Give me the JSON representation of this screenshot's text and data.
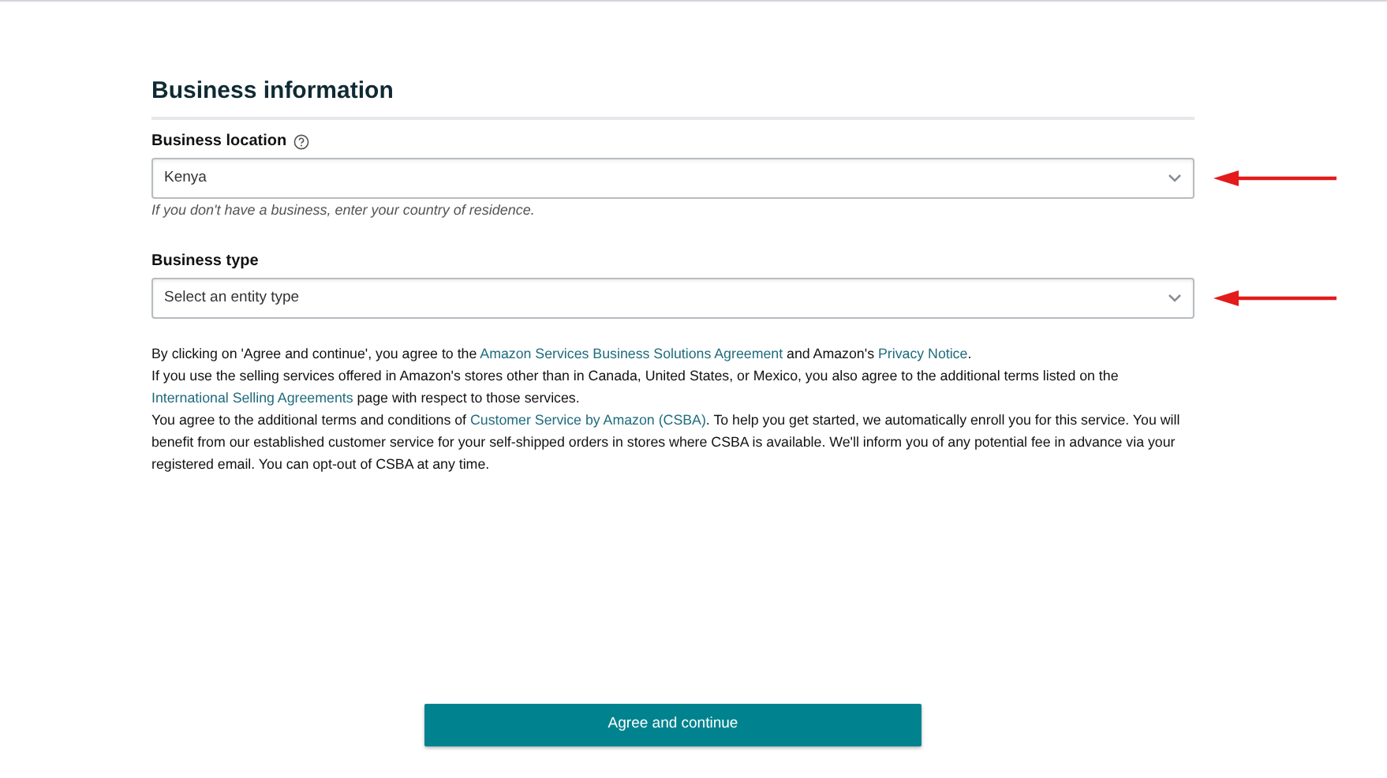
{
  "heading": "Business information",
  "fields": [
    {
      "label": "Business location",
      "help_icon": true,
      "value": "Kenya",
      "hint": "If you don't have a business, enter your country of residence.",
      "annotated": true
    },
    {
      "label": "Business type",
      "help_icon": false,
      "placeholder": "Select an entity type",
      "annotated": true
    }
  ],
  "paragraphs": [
    [
      {
        "text": "By clicking on 'Agree and continue', you agree to the ",
        "link": false
      },
      {
        "text": "Amazon Services Business Solutions Agreement",
        "link": true
      },
      {
        "text": " and Amazon's ",
        "link": false
      },
      {
        "text": "Privacy Notice",
        "link": true
      },
      {
        "text": ".",
        "link": false
      }
    ],
    [
      {
        "text": "If you use the selling services offered in Amazon's stores other than in Canada, United States, or Mexico, you also agree to the additional terms listed on the ",
        "link": false
      },
      {
        "text": "International Selling Agreements",
        "link": true
      },
      {
        "text": " page with respect to those services.",
        "link": false
      }
    ],
    [
      {
        "text": "You agree to the additional terms and conditions of ",
        "link": false
      },
      {
        "text": "Customer Service by Amazon (CSBA)",
        "link": true
      },
      {
        "text": ". To help you get started, we automatically enroll you for this service. You will benefit from our established customer service for your self-shipped orders in stores where CSBA is available. We'll inform you of any potential fee in advance via your registered email. You can opt-out of CSBA at any time.",
        "link": false
      }
    ]
  ],
  "button": "Agree and continue"
}
